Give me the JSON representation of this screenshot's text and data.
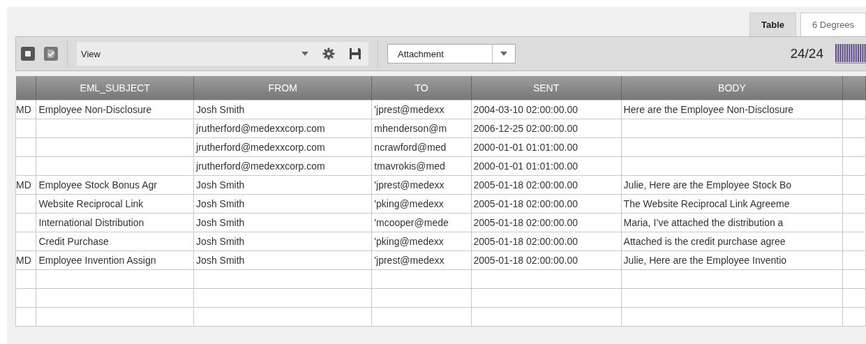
{
  "tabs": [
    {
      "label": "Table",
      "selected": true
    },
    {
      "label": "6 Degrees",
      "selected": false
    }
  ],
  "toolbar": {
    "view_select": {
      "value": "View"
    },
    "field_select": {
      "value": "Attachment"
    },
    "count": "24/24"
  },
  "table": {
    "columns": [
      "",
      "EML_SUBJECT",
      "FROM",
      "TO",
      "SENT",
      "BODY"
    ],
    "rows": [
      [
        "MD",
        "Employee Non-Disclosure",
        "Josh Smith",
        "'jprest@medexx",
        "2004-03-10 02:00:00.00",
        "Here are the Employee Non-Disclosure"
      ],
      [
        "",
        "",
        "jrutherford@medexxcorp.com",
        "mhenderson@m",
        "2006-12-25 02:00:00.00",
        ""
      ],
      [
        "",
        "",
        "jrutherford@medexxcorp.com",
        "ncrawford@med",
        "2000-01-01 01:01:00.00",
        ""
      ],
      [
        "",
        "",
        "jrutherford@medexxcorp.com",
        "tmavrokis@med",
        "2000-01-01 01:01:00.00",
        ""
      ],
      [
        "MD",
        "Employee Stock Bonus Agr",
        "Josh Smith",
        "'jprest@medexx",
        "2005-01-18 02:00:00.00",
        "Julie, Here are the Employee Stock Bo"
      ],
      [
        "",
        "Website Reciprocal Link",
        "Josh Smith",
        "'pking@medexx",
        "2005-01-18 02:00:00.00",
        "The Website Reciprocal Link Agreeme"
      ],
      [
        "",
        "International Distribution",
        "Josh Smith",
        "'mcooper@mede",
        "2005-01-18 02:00:00.00",
        "Maria, I’ve attached the distribution a"
      ],
      [
        "",
        "Credit Purchase",
        "Josh Smith",
        "'pking@medexx",
        "2005-01-18 02:00:00.00",
        "Attached is the credit purchase agree"
      ],
      [
        "MD",
        "Employee Invention Assign",
        "Josh Smith",
        "'jprest@medexx",
        "2005-01-18 02:00:00.00",
        "Julie, Here are the Employee Inventio"
      ],
      [
        "",
        "",
        "",
        "",
        "",
        ""
      ],
      [
        "",
        "",
        "",
        "",
        "",
        ""
      ],
      [
        "",
        "",
        "",
        "",
        "",
        ""
      ]
    ]
  }
}
